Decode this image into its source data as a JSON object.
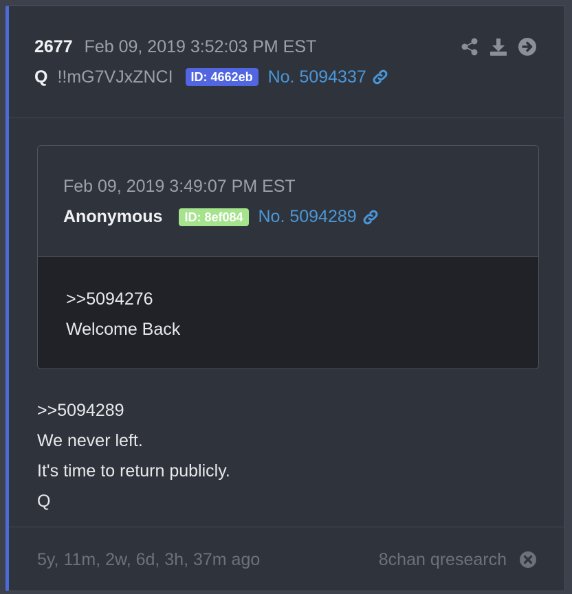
{
  "post": {
    "number": "2677",
    "date": "Feb 09, 2019 3:52:03 PM EST",
    "author": "Q",
    "tripcode": "!!mG7VJxZNCI",
    "id": "ID: 4662eb",
    "post_no": "No. 5094337",
    "message": [
      ">>5094289",
      "We never left.",
      "It's time to return publicly.",
      "Q"
    ],
    "colors": {
      "accent": "#4c6bd6",
      "id_badge": "#5166e0",
      "link": "#4a97d9"
    },
    "action_icons": [
      "share-icon",
      "download-icon",
      "arrow-right-circle-icon"
    ]
  },
  "quoted": {
    "date": "Feb 09, 2019 3:49:07 PM EST",
    "author": "Anonymous",
    "id": "ID: 8ef084",
    "post_no": "No. 5094289",
    "message": [
      ">>5094276",
      "Welcome Back"
    ],
    "colors": {
      "id_badge": "#a5e38d"
    }
  },
  "footer": {
    "elapsed": "5y, 11m, 2w, 6d, 3h, 37m ago",
    "source": "8chan qresearch",
    "close_icon": "close-circle-icon"
  }
}
